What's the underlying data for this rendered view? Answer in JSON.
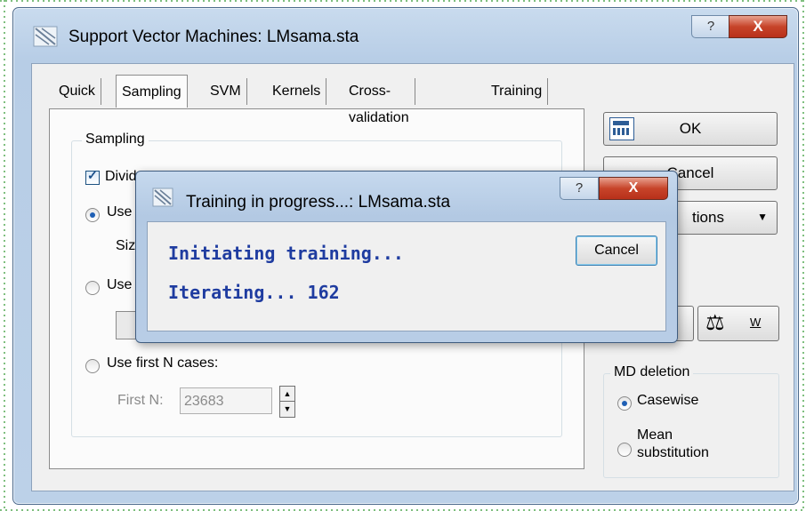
{
  "window": {
    "title": "Support Vector Machines: LMsama.sta",
    "help_label": "?",
    "close_label": "X"
  },
  "tabs": [
    {
      "label": "Quick"
    },
    {
      "label": "Sampling"
    },
    {
      "label": "SVM"
    },
    {
      "label": "Kernels"
    },
    {
      "label": "Cross-validation"
    },
    {
      "label": "Training"
    }
  ],
  "sampling": {
    "group_label": "Sampling",
    "divide_label": "Divide",
    "divide_checked": true,
    "use_label_1": "Use",
    "size_label": "Siz",
    "use_label_2": "Use",
    "first_n_option": "Use first N cases:",
    "first_n_label": "First N:",
    "first_n_value": "23683"
  },
  "buttons": {
    "ok": "OK",
    "cancel": "Cancel",
    "options": "tions",
    "w": "W"
  },
  "md_deletion": {
    "group_label": "MD deletion",
    "options": [
      "Casewise",
      "Mean substitution"
    ],
    "selected": "Casewise"
  },
  "progress_dialog": {
    "title": "Training in progress...: LMsama.sta",
    "help_label": "?",
    "close_label": "X",
    "message_1": "Initiating training...",
    "message_2": "Iterating... 162",
    "cancel_label": "Cancel"
  },
  "colors": {
    "message_text": "#1f3ca0",
    "close_red": "#c7442a",
    "radio_selected": "#1e5fb4"
  }
}
